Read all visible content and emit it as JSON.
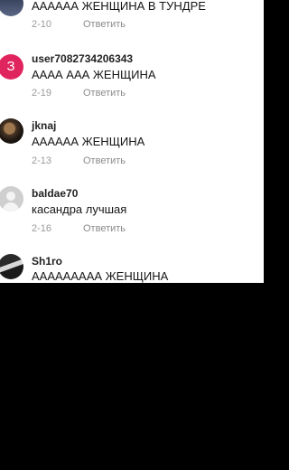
{
  "reply_label": "Ответить",
  "comments": [
    {
      "avatar": "avatar-image-icon",
      "username": "",
      "text": "АААААА ЖЕНЩИНА В ТУНДРЕ",
      "date": "2-10"
    },
    {
      "avatar_letter": "З",
      "username": "user7082734206343",
      "text": "АААА ААА ЖЕНЩИНА",
      "date": "2-19"
    },
    {
      "avatar": "avatar-photo-icon",
      "username": "jknaj",
      "text": "АААААА ЖЕНЩИНА",
      "date": "2-13"
    },
    {
      "avatar": "default-avatar-icon",
      "username": "baldae70",
      "text": "касандра лучшая",
      "date": "2-16"
    },
    {
      "avatar": "anime-avatar-icon",
      "username": "Sh1ro",
      "text": "ААААААААА ЖЕНЩИНА",
      "date": ""
    }
  ]
}
